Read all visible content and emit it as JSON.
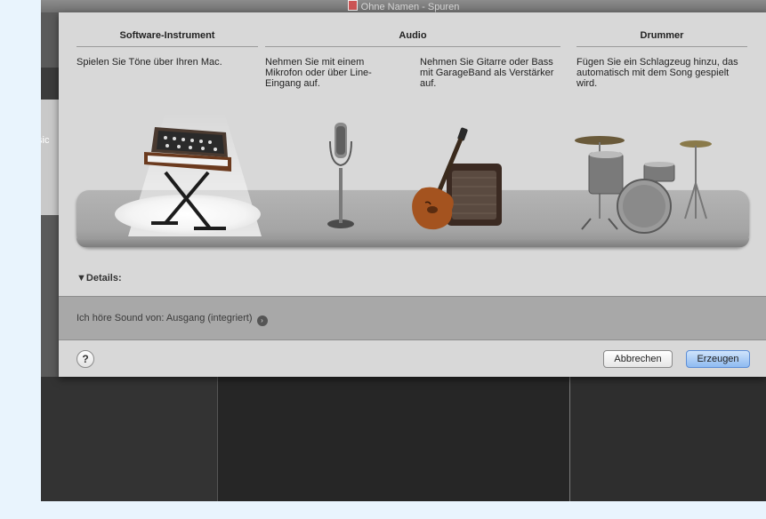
{
  "window": {
    "title": "Ohne Namen - Spuren",
    "side_label": "sic"
  },
  "columns": {
    "software": {
      "heading": "Software-Instrument",
      "desc": "Spielen Sie Töne über Ihren Mac."
    },
    "audio": {
      "heading": "Audio",
      "desc_mic": "Nehmen Sie mit einem Mikrofon oder über Line-Eingang auf.",
      "desc_guitar": "Nehmen Sie Gitarre oder Bass mit GarageBand als Verstärker auf."
    },
    "drummer": {
      "heading": "Drummer",
      "desc": "Fügen Sie ein Schlagzeug hinzu, das automatisch mit dem Song gespielt wird."
    }
  },
  "details_label": "▼Details:",
  "output": {
    "text": "Ich höre Sound von: Ausgang (integriert)",
    "arrow_glyph": "›"
  },
  "buttons": {
    "help": "?",
    "cancel": "Abbrechen",
    "create": "Erzeugen"
  },
  "icons": [
    "document-icon",
    "keyboard-synth-icon",
    "microphone-icon",
    "guitar-amp-icon",
    "drum-kit-icon",
    "help-icon",
    "arrow-right-icon"
  ],
  "colors": {
    "accent_button": "#8ebaf1",
    "sheet_bg": "#d8d8d8",
    "stage": "#a5a5a5"
  }
}
